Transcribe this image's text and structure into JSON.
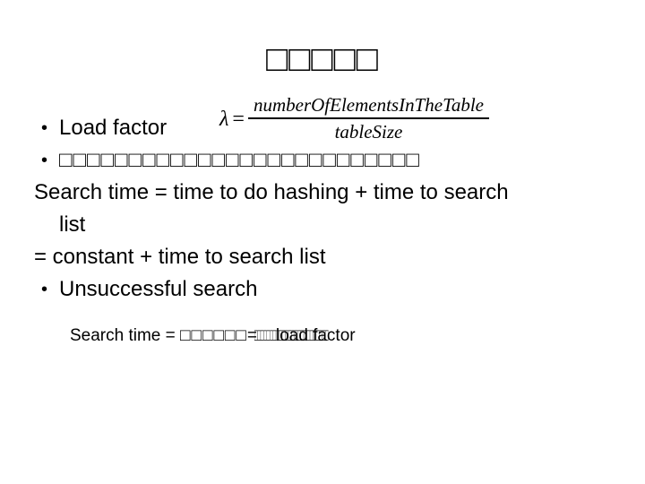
{
  "slide": {
    "title": "□□□□□",
    "background_color": "#ffffff",
    "text_color": "#000000"
  },
  "content": {
    "bullet1": {
      "label": "Load factor",
      "formula": {
        "variable": "λ",
        "equals": "=",
        "numerator": "numberOfElementsInTheTable",
        "denominator": "tableSize"
      }
    },
    "bullet2": {
      "text": "□□□□□□□□□□□□□□□□□□□□□□□□□□"
    },
    "line3": "Search time = time to do hashing + time to search",
    "line4": "list",
    "line5": "= constant + time to search list",
    "bullet3": {
      "text": "Unsuccessful search"
    },
    "subline": {
      "prefix": "Search time = ",
      "tofu_wide": "□□□□□□",
      "equals": "=",
      "tofu_condensed": "□□□□□□□□□□□□□□□□□□□□□□□□",
      "overlay_text": "load factor"
    }
  }
}
